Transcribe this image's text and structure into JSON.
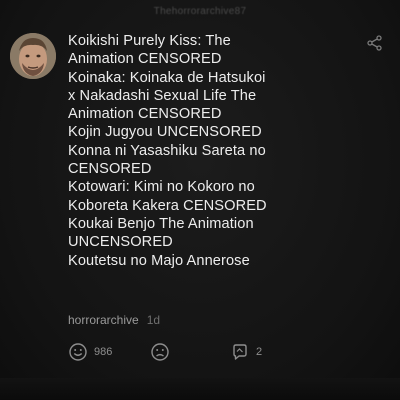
{
  "header": {
    "faded_username": "Thehorrorarchive87"
  },
  "comment": {
    "lines": [
      "Koikishi Purely Kiss: The",
      "Animation CENSORED",
      "Koinaka: Koinaka de Hatsukoi",
      "x Nakadashi Sexual Life The",
      "Animation CENSORED",
      "Kojin Jugyou UNCENSORED",
      "Konna ni Yasashiku Sareta no",
      "CENSORED",
      "Kotowari: Kimi no Kokoro no",
      "Koboreta Kakera CENSORED",
      "Koukai Benjo The Animation",
      "UNCENSORED",
      "Koutetsu no Majo Annerose"
    ],
    "author": "horrorarchive",
    "age": "1d"
  },
  "actions": {
    "like_count": "986",
    "reply_count": "2"
  },
  "colors": {
    "background": "#141414",
    "text": "#ededed",
    "muted": "#8e8e8e"
  },
  "icons": {
    "avatar": "avatar",
    "share": "share-icon",
    "like": "smile-reaction-icon",
    "dislike": "sad-reaction-icon",
    "reply": "reply-icon"
  }
}
